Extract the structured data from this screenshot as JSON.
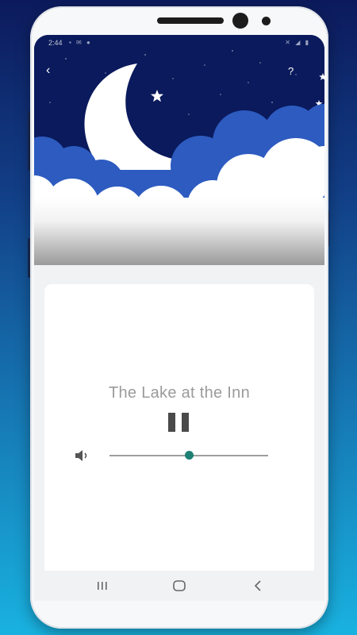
{
  "status_bar": {
    "time": "2:44",
    "left_icons": [
      "image-icon",
      "sync-icon",
      "chat-icon"
    ],
    "right_icons": [
      "mute-icon",
      "wifi-icon",
      "signal-icon",
      "battery-icon"
    ]
  },
  "header": {
    "back_icon": "‹",
    "help_icon": "?"
  },
  "player": {
    "track_title": "The Lake at the Inn",
    "state": "playing",
    "volume": 0.5
  },
  "nav": {
    "recents_icon": "recents-icon",
    "home_icon": "home-icon",
    "back_icon": "back-icon"
  },
  "colors": {
    "background_top": "#0c1a5c",
    "background_bottom": "#19b2e0",
    "sky": "#0a1a5c",
    "cloud_blue": "#2d5bc0",
    "accent": "#1e7f74",
    "title_text": "#9b9b9b"
  }
}
